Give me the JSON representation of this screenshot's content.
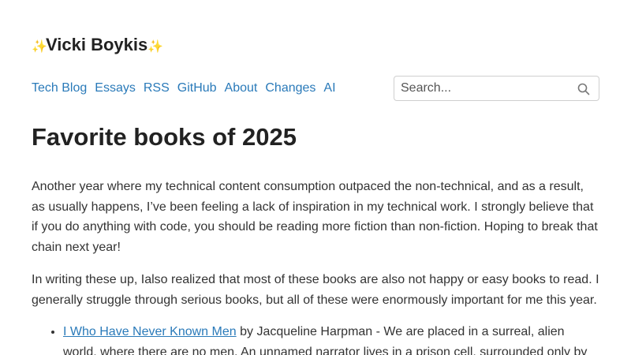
{
  "site": {
    "title": "Vicki Boykis",
    "sparkle_left": "✨",
    "sparkle_right": "✨"
  },
  "nav": {
    "items": [
      {
        "label": "Tech Blog"
      },
      {
        "label": "Essays"
      },
      {
        "label": "RSS"
      },
      {
        "label": "GitHub"
      },
      {
        "label": "About"
      },
      {
        "label": "Changes"
      },
      {
        "label": "AI"
      }
    ]
  },
  "search": {
    "placeholder": "Search...",
    "icon": "search-icon"
  },
  "post": {
    "title": "Favorite books of 2025",
    "paragraphs": [
      "Another year where my technical content consumption outpaced the non-technical, and as a result, as usually happens, I’ve been feeling a lack of inspiration in my technical work. I strongly believe that if you do anything with code, you should be reading more fiction than non-fiction. Hoping to break that chain next year!",
      "In writing these up, Ialso realized that most of these books are also not happy or easy books to read. I generally struggle through serious books, but all of these were enormously important for me this year."
    ],
    "books": [
      {
        "title": "I Who Have Never Known Men",
        "description": " by Jacqueline Harpman - We are placed in a surreal, alien world, where there are no men. An unnamed narrator lives in a prison cell, surrounded only by"
      }
    ]
  },
  "colors": {
    "link": "#2a7ab9",
    "text": "#222222",
    "border": "#cfcfcf"
  }
}
